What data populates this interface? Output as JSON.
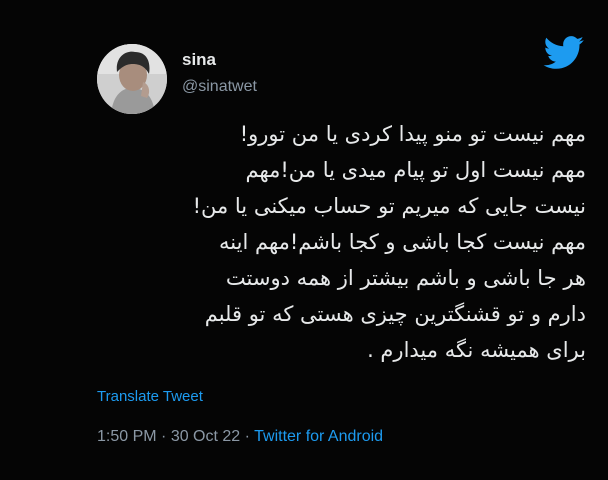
{
  "author": {
    "display_name": "sina",
    "handle": "@sinatwet"
  },
  "tweet": {
    "lines": [
      "مهم نیست تو منو پیدا کردی یا من تورو!",
      "مهم نیست اول تو پیام میدی یا من!مهم",
      "نیست جایی که میریم تو حساب میکنی یا من!",
      "مهم نیست کجا باشی و کجا باشم!مهم اینه",
      "هر جا باشی و باشم بیشتر از همه دوستت",
      "دارم و تو قشنگترین چیزی هستی که تو قلبم",
      "برای همیشه نگه میدارم ."
    ]
  },
  "translate_label": "Translate Tweet",
  "meta": {
    "time": "1:50 PM",
    "separator": " · ",
    "date": "30 Oct 22",
    "source": "Twitter for Android"
  },
  "icons": {
    "brand": "twitter-bird-icon",
    "avatar": "profile-photo"
  },
  "colors": {
    "background": "#050505",
    "text": "#e7e9ea",
    "muted": "#8b98a5",
    "accent": "#1d9bf0"
  }
}
